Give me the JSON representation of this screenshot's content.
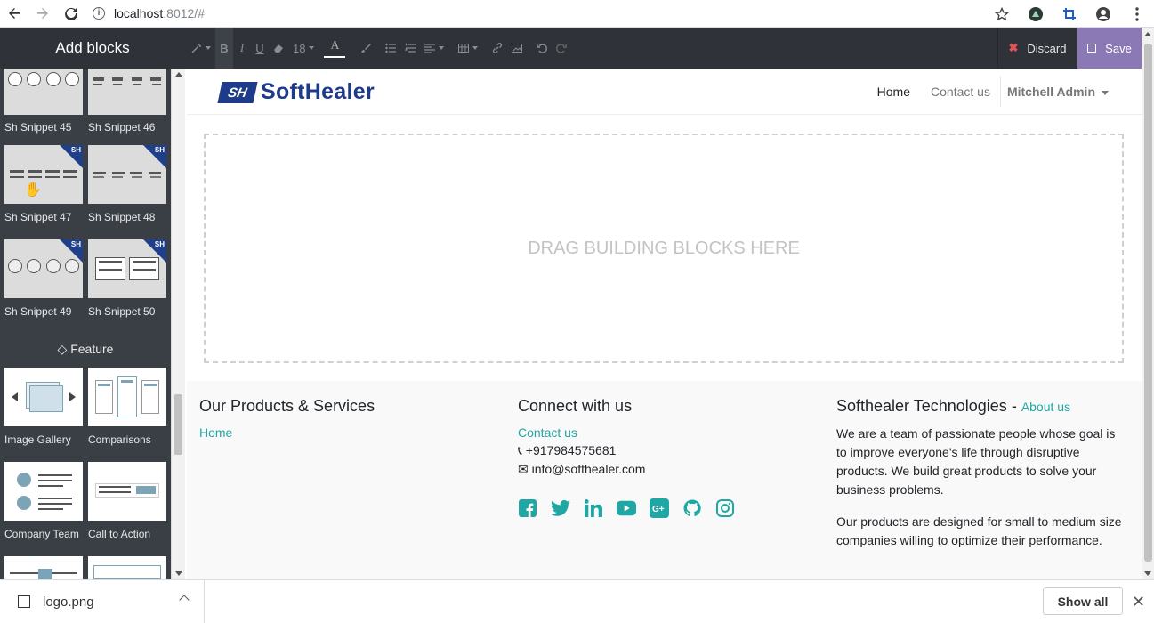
{
  "browser": {
    "url_host": "localhost",
    "url_path": ":8012/#"
  },
  "editor": {
    "sidebar_title": "Add blocks",
    "font_size": "18",
    "discard_label": "Discard",
    "save_label": "Save",
    "accent_color": "#8a79b5"
  },
  "sidebar": {
    "snippets": [
      {
        "label": "Sh Snippet 45"
      },
      {
        "label": "Sh Snippet 46"
      },
      {
        "label": "Sh Snippet 47"
      },
      {
        "label": "Sh Snippet 48"
      },
      {
        "label": "Sh Snippet 49"
      },
      {
        "label": "Sh Snippet 50"
      }
    ],
    "badge_text": "SH",
    "category_feature": "Feature",
    "features": [
      {
        "label": "Image Gallery"
      },
      {
        "label": "Comparisons"
      },
      {
        "label": "Company Team"
      },
      {
        "label": "Call to Action"
      }
    ]
  },
  "site": {
    "logo_mark": "SH",
    "logo_text": "SoftHealer",
    "nav": {
      "home": "Home",
      "contact": "Contact us",
      "user": "Mitchell Admin"
    },
    "dropzone_text": "DRAG BUILDING BLOCKS HERE",
    "footer": {
      "products_title": "Our Products & Services",
      "products_link": "Home",
      "connect_title": "Connect with us",
      "connect_link": "Contact us",
      "phone": "+917984575681",
      "email": "info@softhealer.com",
      "company_title": "Softhealer Technologies",
      "company_sep": " - ",
      "about_link": "About us",
      "para1": "We are a team of passionate people whose goal is to improve everyone's life through disruptive products. We build great products to solve your business problems.",
      "para2": "Our products are designed for small to medium size companies willing to optimize their performance.",
      "social_icons": [
        "facebook-icon",
        "twitter-icon",
        "linkedin-icon",
        "youtube-icon",
        "google-plus-icon",
        "github-icon",
        "instagram-icon"
      ]
    }
  },
  "downloads": {
    "file_name": "logo.png",
    "show_all": "Show all"
  }
}
